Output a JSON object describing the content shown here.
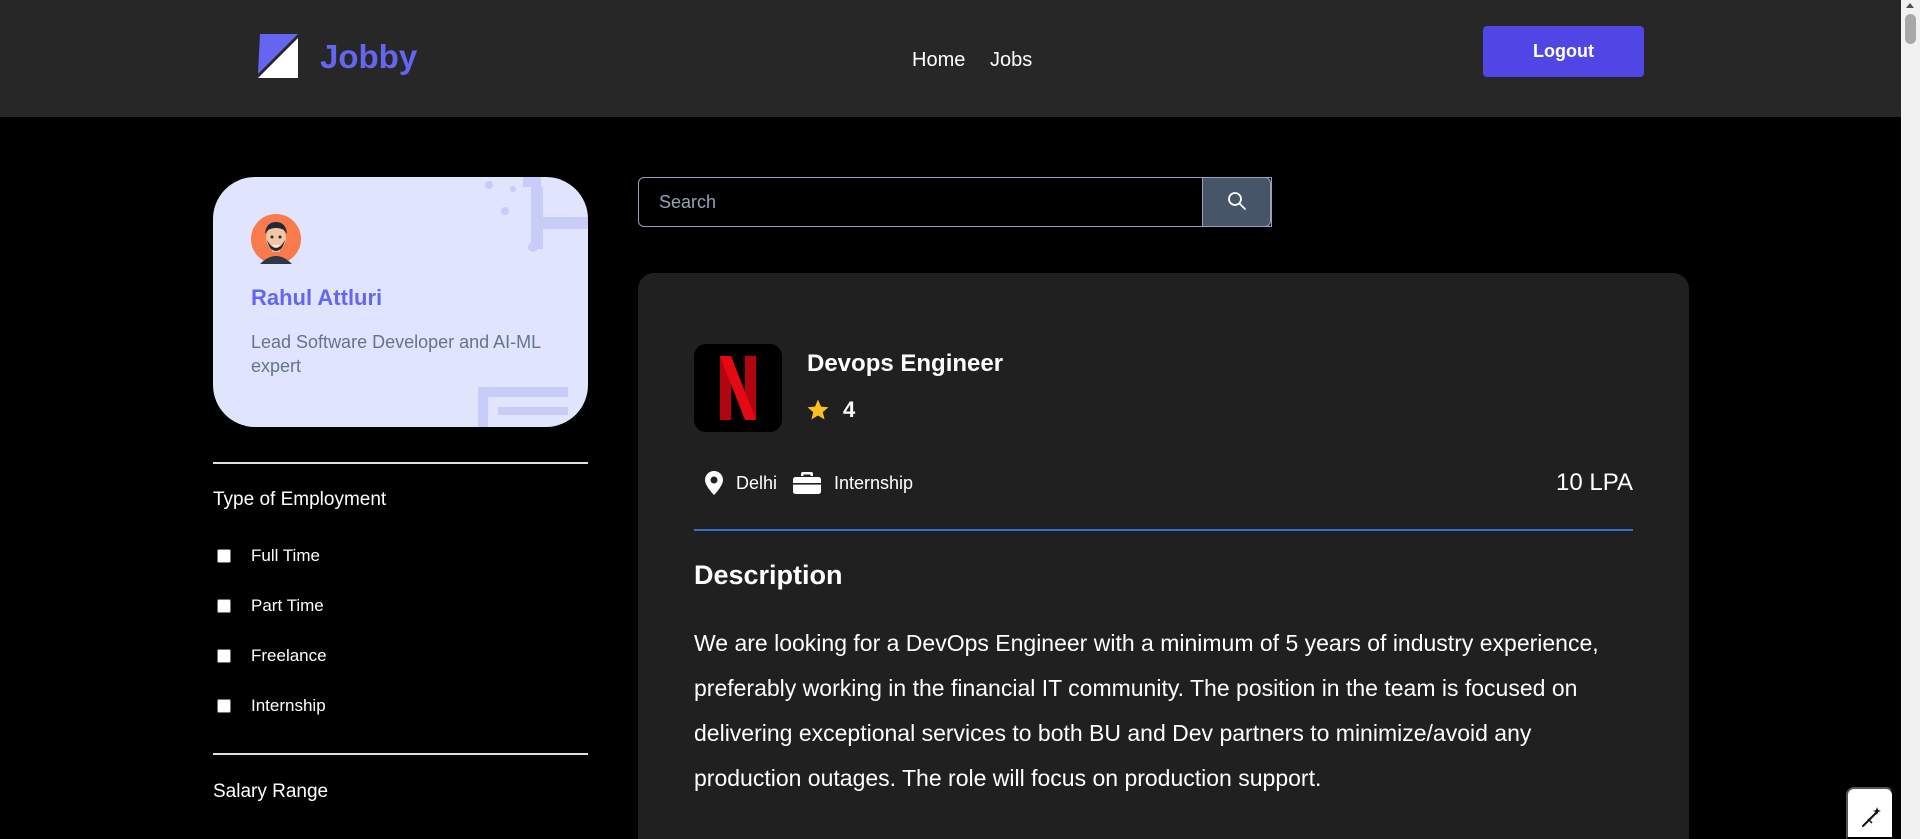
{
  "header": {
    "brand": "Jobby",
    "nav": [
      "Home",
      "Jobs"
    ],
    "logout_label": "Logout"
  },
  "profile": {
    "name": "Rahul Attluri",
    "bio": "Lead Software Developer and AI-ML expert"
  },
  "filters": {
    "employment_heading": "Type of Employment",
    "employment_options": [
      "Full Time",
      "Part Time",
      "Freelance",
      "Internship"
    ],
    "salary_heading": "Salary Range"
  },
  "search": {
    "placeholder": "Search",
    "icon": "search-icon"
  },
  "job": {
    "title": "Devops Engineer",
    "rating": "4",
    "location": "Delhi",
    "employment_type": "Internship",
    "package": "10 LPA",
    "description_heading": "Description",
    "description": "We are looking for a DevOps Engineer with a minimum of 5 years of industry experience, preferably working in the financial IT community. The position in the team is focused on delivering exceptional services to both BU and Dev partners to minimize/avoid any production outages. The role will focus on production support."
  },
  "colors": {
    "accent": "#4f46e5",
    "brand": "#6466f1",
    "star": "#fbbf24",
    "netflix": "#e50914"
  }
}
